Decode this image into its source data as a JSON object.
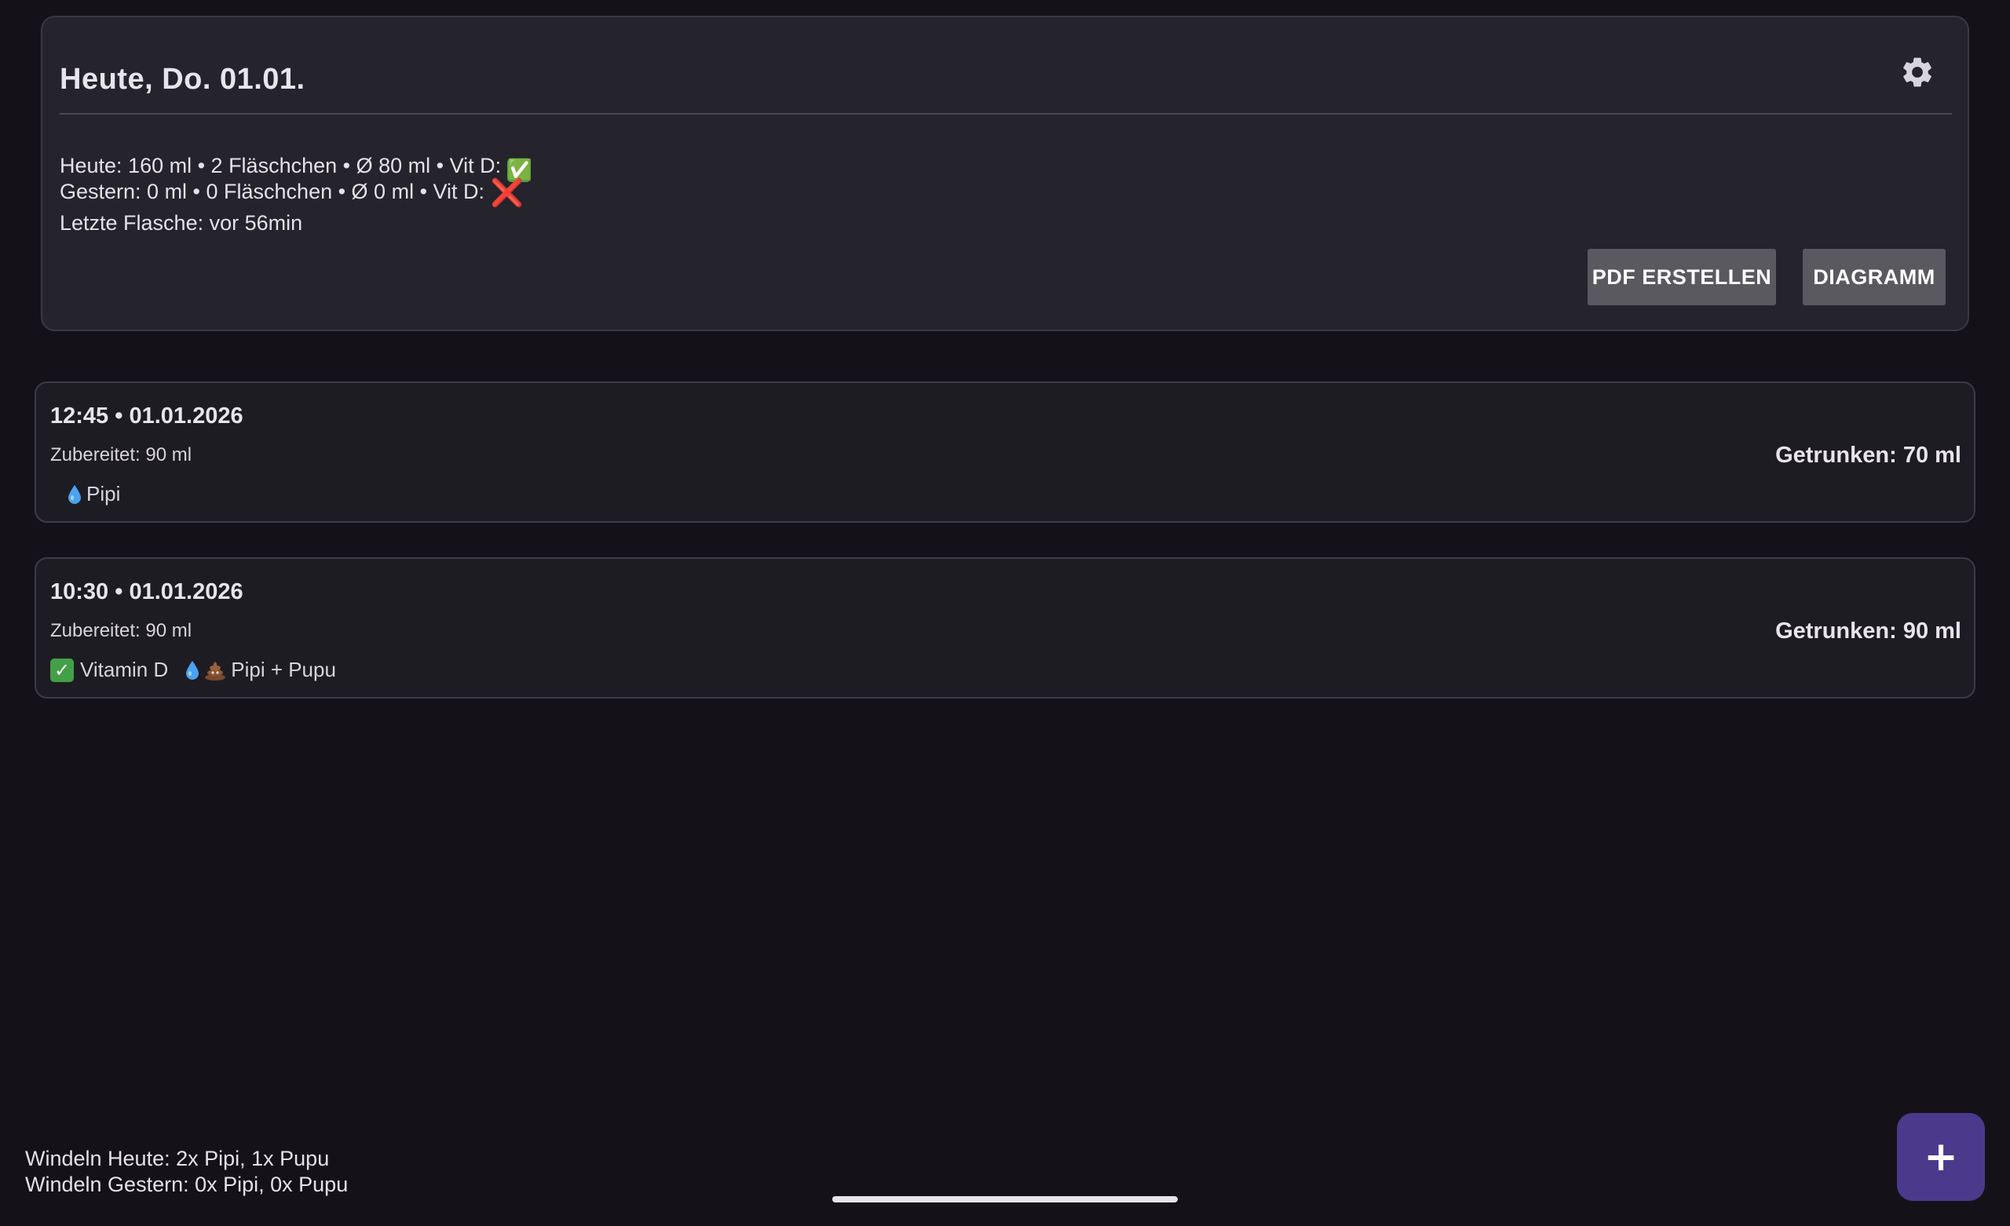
{
  "summary": {
    "title": "Heute, Do. 01.01.",
    "today_text": "Heute: 160 ml • 2 Fläschchen • Ø 80 ml • Vit D: ",
    "today_vitd": "✅",
    "yesterday_text": "Gestern: 0 ml • 0 Fläschchen • Ø 0 ml • Vit D: ",
    "yesterday_vitd": "❌",
    "last_bottle": "Letzte Flasche: vor 56min",
    "settings_icon": "gear-icon",
    "buttons": {
      "pdf": "PDF ERSTELLEN",
      "diagram": "DIAGRAMM"
    }
  },
  "entries": [
    {
      "time": "12:45 • 01.01.2026",
      "prepared": "Zubereitet: 90 ml",
      "drunk": "Getrunken: 70 ml",
      "diaper_label": "Pipi"
    },
    {
      "time": "10:30 • 01.01.2026",
      "prepared": "Zubereitet: 90 ml",
      "drunk": "Getrunken: 90 ml",
      "vitamin_label": "Vitamin D",
      "diaper_label": "Pipi + Pupu"
    }
  ],
  "footer": {
    "diapers_today": "Windeln Heute: 2x Pipi, 1x Pupu",
    "diapers_yesterday": "Windeln Gestern: 0x Pipi, 0x Pupu",
    "fab_label": "+"
  },
  "colors": {
    "background": "#141218",
    "card": "#25232b",
    "accent": "#4b3a8c",
    "button": "#5a5960",
    "check": "#43a047",
    "cross": "#e53935"
  }
}
